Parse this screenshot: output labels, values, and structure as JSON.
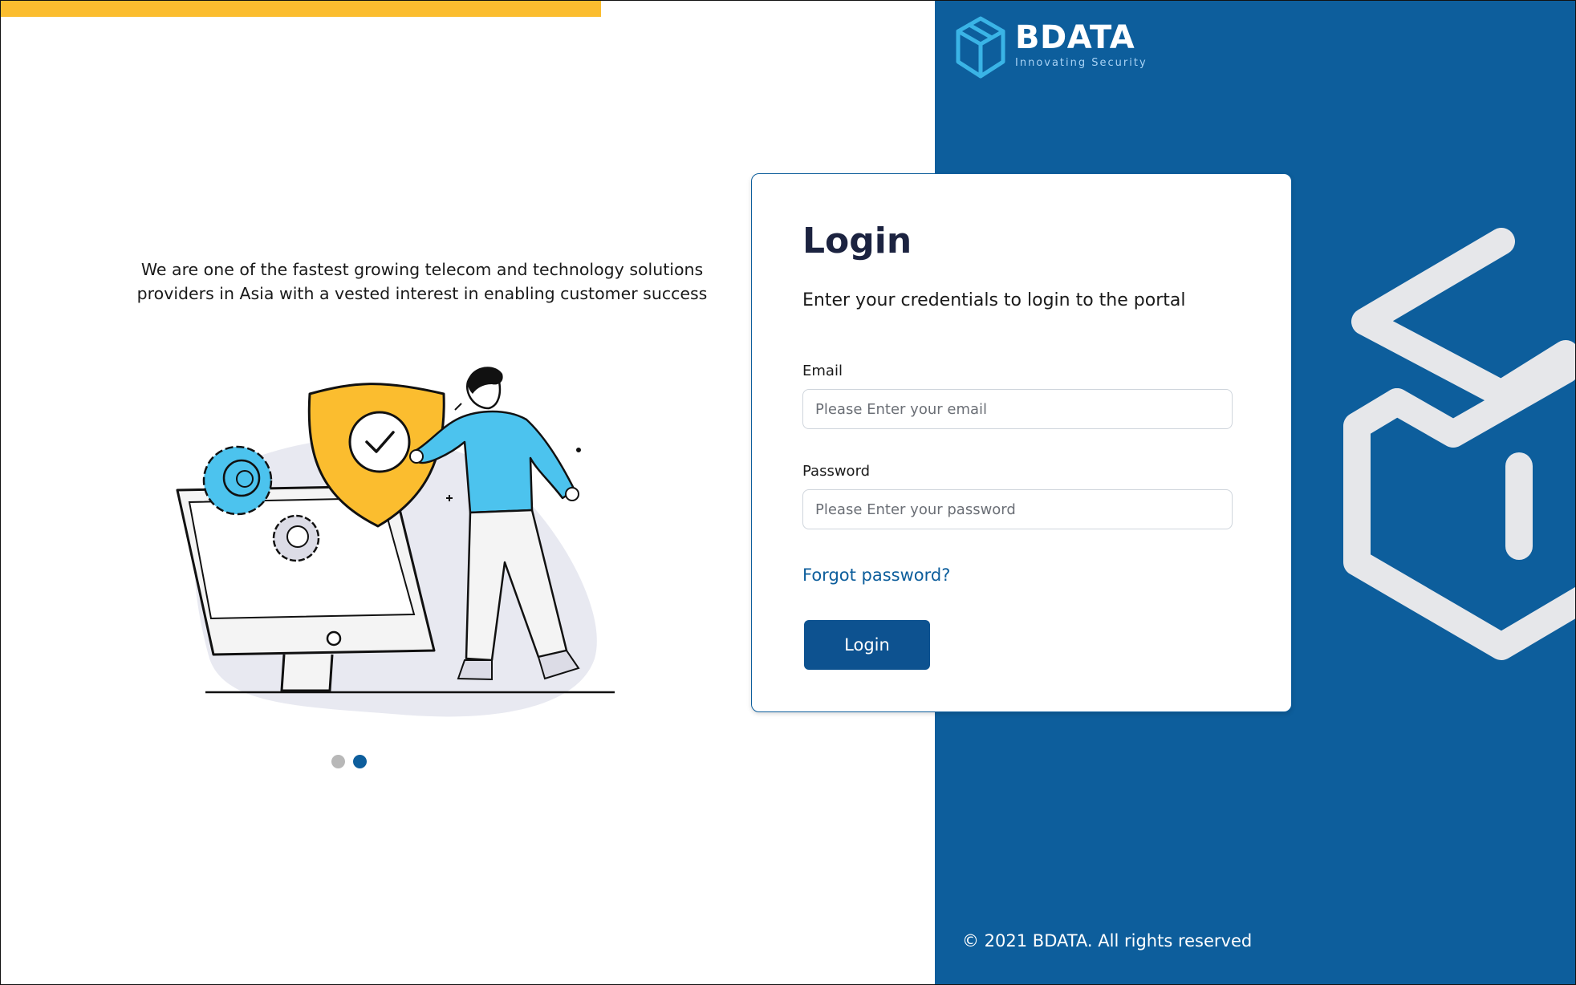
{
  "brand": {
    "name": "BDATA",
    "tagline": "Innovating Security"
  },
  "hero": {
    "text_line1": "We are one of the fastest growing telecom and technology solutions",
    "text_line2": "providers in Asia with a vested interest in enabling customer success",
    "carousel": {
      "total": 2,
      "active_index": 2
    }
  },
  "login": {
    "title": "Login",
    "subtitle": "Enter your credentials to login to the portal",
    "email_label": "Email",
    "email_placeholder": "Please Enter your email",
    "password_label": "Password",
    "password_placeholder": "Please Enter your password",
    "forgot_link": "Forgot password?",
    "submit_label": "Login"
  },
  "footer": {
    "copyright": "© 2021 BDATA. All rights reserved"
  },
  "colors": {
    "accent_yellow": "#fbbd2f",
    "brand_blue": "#0d5e9c",
    "button_blue": "#0d5290",
    "title_navy": "#1c2340"
  }
}
